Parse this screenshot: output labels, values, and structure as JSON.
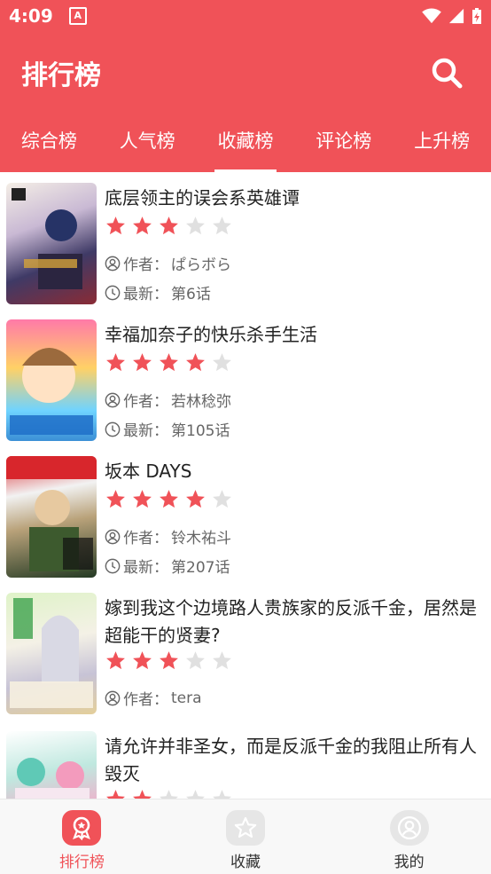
{
  "status": {
    "time": "4:09"
  },
  "appbar": {
    "title": "排行榜"
  },
  "tabs": [
    {
      "label": "综合榜",
      "active": false
    },
    {
      "label": "人气榜",
      "active": false
    },
    {
      "label": "收藏榜",
      "active": true
    },
    {
      "label": "评论榜",
      "active": false
    },
    {
      "label": "上升榜",
      "active": false
    }
  ],
  "labels": {
    "author_prefix": "作者：",
    "latest_prefix": "最新："
  },
  "items": [
    {
      "title": "底层领主的误会系英雄谭",
      "rating": 3,
      "author": "ぱらボら",
      "latest": "第6话"
    },
    {
      "title": "幸福加奈子的快乐杀手生活",
      "rating": 4,
      "author": "若林稔弥",
      "latest": "第105话"
    },
    {
      "title": "坂本 DAYS",
      "rating": 4,
      "author": "铃木祐斗",
      "latest": "第207话"
    },
    {
      "title": "嫁到我这个边境路人贵族家的反派千金，居然是超能干的贤妻?",
      "rating": 3,
      "author": "tera"
    },
    {
      "title": "请允许并非圣女，而是反派千金的我阻止所有人毁灭",
      "rating": 2
    }
  ],
  "bottom_nav": [
    {
      "label": "排行榜",
      "active": true
    },
    {
      "label": "收藏",
      "active": false
    },
    {
      "label": "我的",
      "active": false
    }
  ],
  "colors": {
    "accent": "#f05258",
    "star_on": "#f05258",
    "star_off": "#e0e0e0",
    "nav_inactive": "#333333"
  }
}
